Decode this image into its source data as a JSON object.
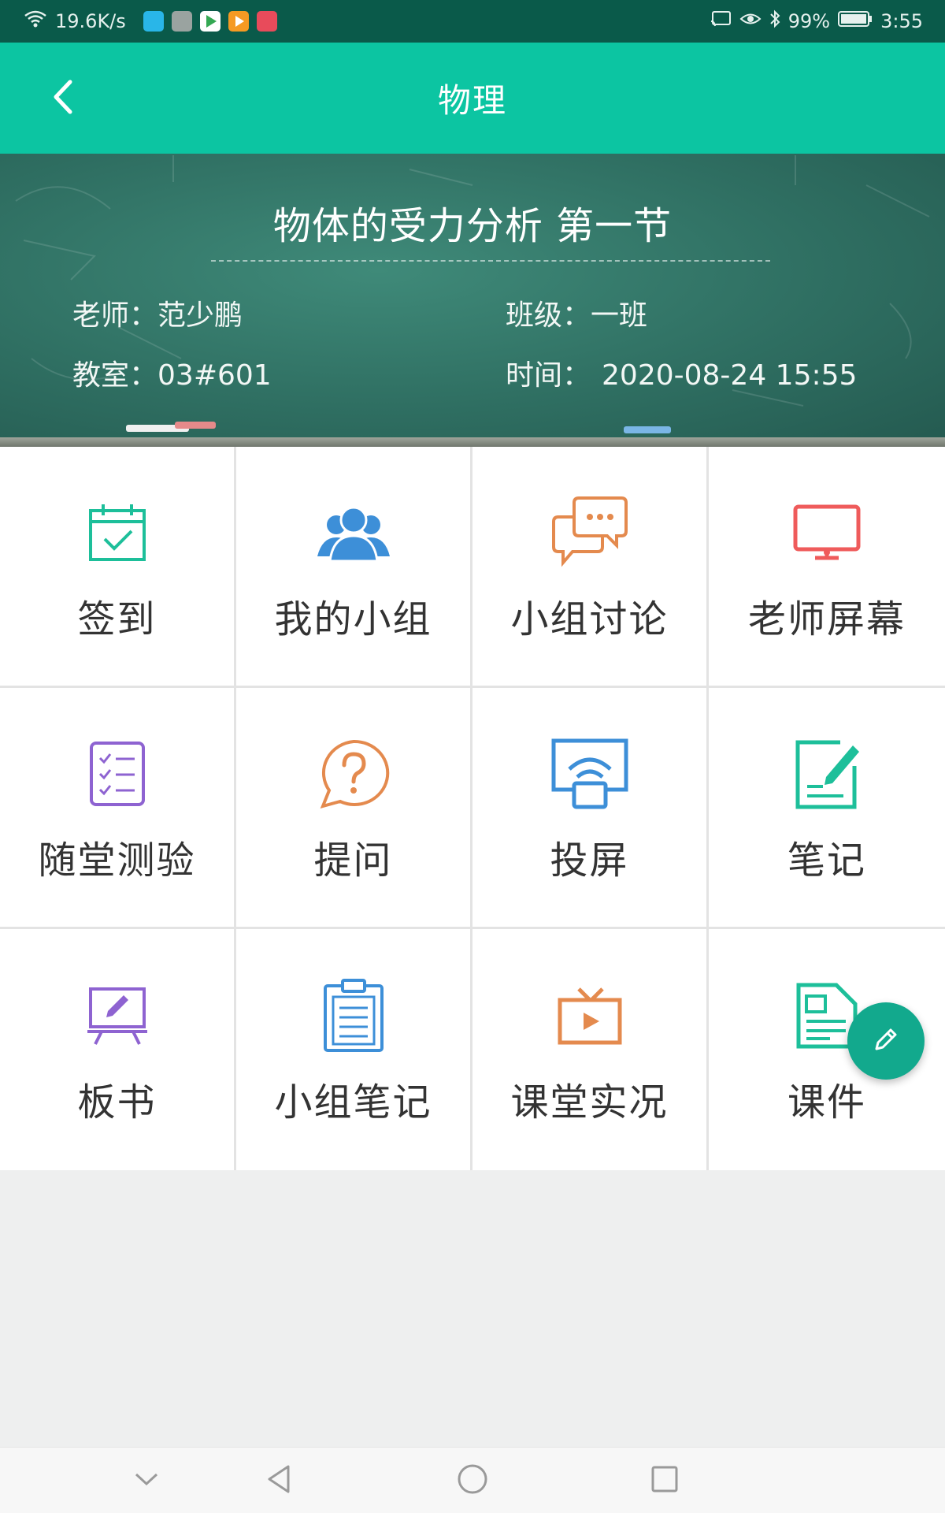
{
  "status_bar": {
    "speed": "19.6K/s",
    "battery": "99%",
    "time": "3:55"
  },
  "app_bar": {
    "title": "物理"
  },
  "lesson": {
    "title": "物体的受力分析 第一节",
    "teacher_label": "老师：",
    "teacher": "范少鹏",
    "class_label": "班级：",
    "class": "一班",
    "room_label": "教室：",
    "room": "03#601",
    "time_label": "时间：",
    "time": "2020-08-24 15:55"
  },
  "features": [
    {
      "label": "签到",
      "icon": "calendar-check-icon",
      "color": "#1dbf9a"
    },
    {
      "label": "我的小组",
      "icon": "group-icon",
      "color": "#3d8fd8"
    },
    {
      "label": "小组讨论",
      "icon": "chat-bubbles-icon",
      "color": "#e48a4e"
    },
    {
      "label": "老师屏幕",
      "icon": "monitor-icon",
      "color": "#ef5b5b"
    },
    {
      "label": "随堂测验",
      "icon": "checklist-icon",
      "color": "#8e63d1"
    },
    {
      "label": "提问",
      "icon": "question-bubble-icon",
      "color": "#e48a4e"
    },
    {
      "label": "投屏",
      "icon": "screencast-icon",
      "color": "#3d8fd8"
    },
    {
      "label": "笔记",
      "icon": "note-edit-icon",
      "color": "#1dbf9a"
    },
    {
      "label": "板书",
      "icon": "easel-icon",
      "color": "#8e63d1"
    },
    {
      "label": "小组笔记",
      "icon": "clipboard-icon",
      "color": "#3d8fd8"
    },
    {
      "label": "课堂实况",
      "icon": "tv-play-icon",
      "color": "#e48a4e"
    },
    {
      "label": "课件",
      "icon": "document-icon",
      "color": "#1dbf9a"
    }
  ],
  "colors": {
    "primary": "#0cc5a2",
    "status_bar": "#0a5a4a",
    "fab": "#12a98d"
  }
}
